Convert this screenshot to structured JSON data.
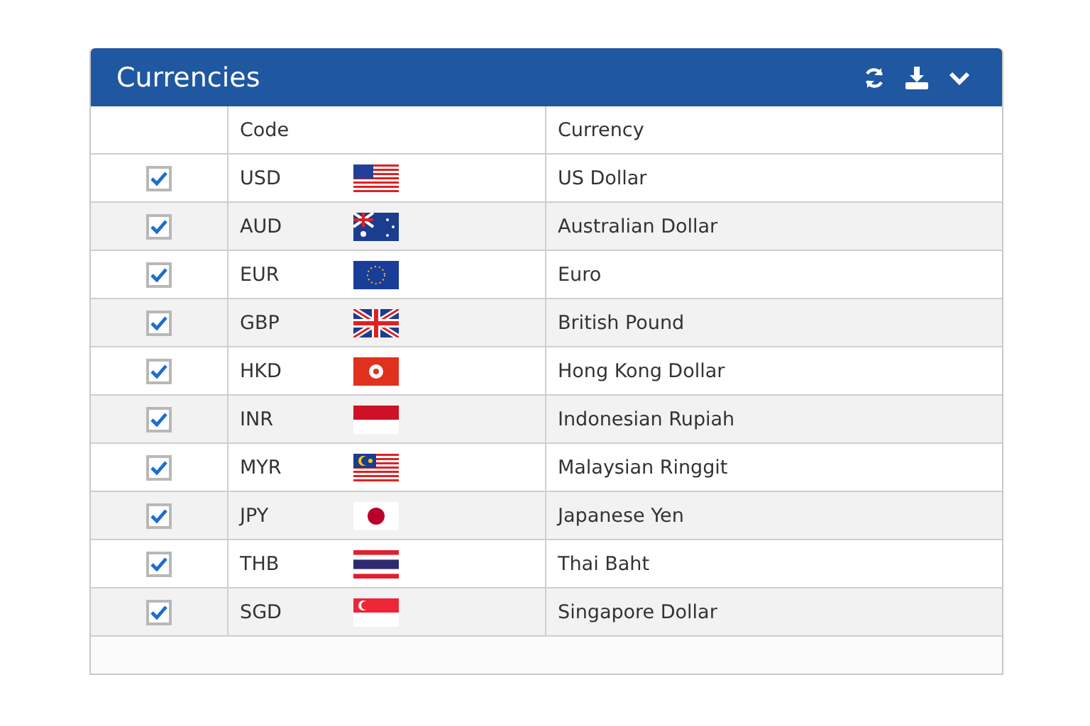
{
  "panel": {
    "title": "Currencies"
  },
  "table": {
    "columns": [
      "Code",
      "Currency"
    ],
    "rows": [
      {
        "checked": true,
        "code": "USD",
        "kind": "us",
        "currency": "US Dollar"
      },
      {
        "checked": true,
        "code": "AUD",
        "kind": "au",
        "currency": "Australian Dollar"
      },
      {
        "checked": true,
        "code": "EUR",
        "kind": "eu",
        "currency": "Euro"
      },
      {
        "checked": true,
        "code": "GBP",
        "kind": "gb",
        "currency": "British Pound"
      },
      {
        "checked": true,
        "code": "HKD",
        "kind": "hk",
        "currency": "Hong Kong Dollar"
      },
      {
        "checked": true,
        "code": "INR",
        "kind": "id",
        "currency": "Indonesian Rupiah"
      },
      {
        "checked": true,
        "code": "MYR",
        "kind": "my",
        "currency": "Malaysian Ringgit"
      },
      {
        "checked": true,
        "code": "JPY",
        "kind": "jp",
        "currency": "Japanese Yen"
      },
      {
        "checked": true,
        "code": "THB",
        "kind": "th",
        "currency": "Thai Baht"
      },
      {
        "checked": true,
        "code": "SGD",
        "kind": "sg",
        "currency": "Singapore Dollar"
      }
    ]
  }
}
